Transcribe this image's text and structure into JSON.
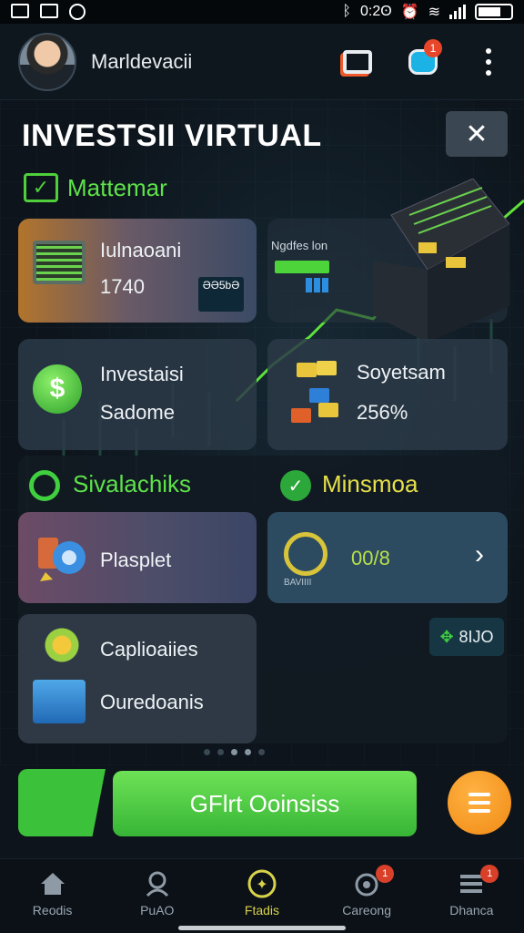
{
  "status_bar": {
    "time": "0:2ʘ"
  },
  "header": {
    "username": "Marldevacii",
    "support_badge": "1"
  },
  "title": {
    "text": "INVESTSII VIRTUAL",
    "close_glyph": "✕"
  },
  "section1": {
    "label": "Mattemar"
  },
  "card_laptop": {
    "title": "Iulnaoani",
    "value": "1740",
    "mini_badge": "ƏƏ5bƏ"
  },
  "card_stat": {
    "label": "Ngdfes lon"
  },
  "card_invest": {
    "line1": "Investaisi",
    "line2": "Sadome"
  },
  "card_system": {
    "line1": "Soyetsam",
    "line2": "256%"
  },
  "section2": {
    "left_label": "Sivalachiks",
    "right_label": "Minsmoa"
  },
  "card_gift": {
    "label": "Plasplet"
  },
  "card_target": {
    "value": "00/8",
    "caption": "BAVIIII"
  },
  "pill": {
    "value": "8IJO"
  },
  "card_settings": {
    "line1": "Caplioaiies",
    "line2": "Ouredoanis"
  },
  "cta": {
    "label": "GFlrt Ooinsiss"
  },
  "nav": [
    {
      "label": "Reodis",
      "icon": "home-icon"
    },
    {
      "label": "PuAO",
      "icon": "user-icon"
    },
    {
      "label": "Ftadis",
      "icon": "star-icon",
      "active": true
    },
    {
      "label": "Careong",
      "icon": "camera-icon",
      "badge": "1"
    },
    {
      "label": "Dhanca",
      "icon": "menu-icon",
      "badge": "1"
    }
  ],
  "colors": {
    "accent": "#4fd03b",
    "cta": "#4fd03b",
    "fab": "#f59a1b"
  }
}
